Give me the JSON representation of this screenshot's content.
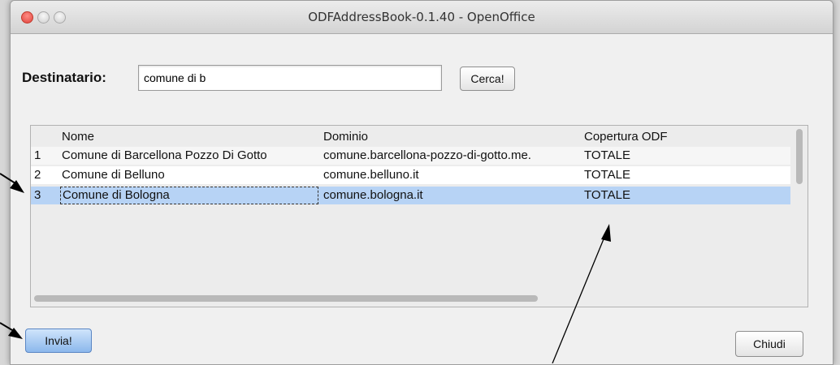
{
  "window": {
    "title": "ODFAddressBook-0.1.40 - OpenOffice"
  },
  "form": {
    "destinatario_label": "Destinatario:",
    "destinatario_value": "comune di b",
    "cerca_label": "Cerca!"
  },
  "table": {
    "headers": {
      "num": "",
      "nome": "Nome",
      "dominio": "Dominio",
      "copertura": "Copertura ODF"
    },
    "rows": [
      {
        "num": "1",
        "nome": "Comune di Barcellona Pozzo Di Gotto",
        "dominio": "comune.barcellona-pozzo-di-gotto.me.",
        "copertura": "TOTALE"
      },
      {
        "num": "2",
        "nome": "Comune di Belluno",
        "dominio": "comune.belluno.it",
        "copertura": "TOTALE"
      },
      {
        "num": "3",
        "nome": "Comune di Bologna",
        "dominio": "comune.bologna.it",
        "copertura": "TOTALE"
      }
    ],
    "selected_row": 3
  },
  "buttons": {
    "invia": "Invia!",
    "chiudi": "Chiudi"
  },
  "colors": {
    "selection": "#b7d3f5",
    "primary_button": "#8cb8ec",
    "close_light": "#e0443e"
  }
}
